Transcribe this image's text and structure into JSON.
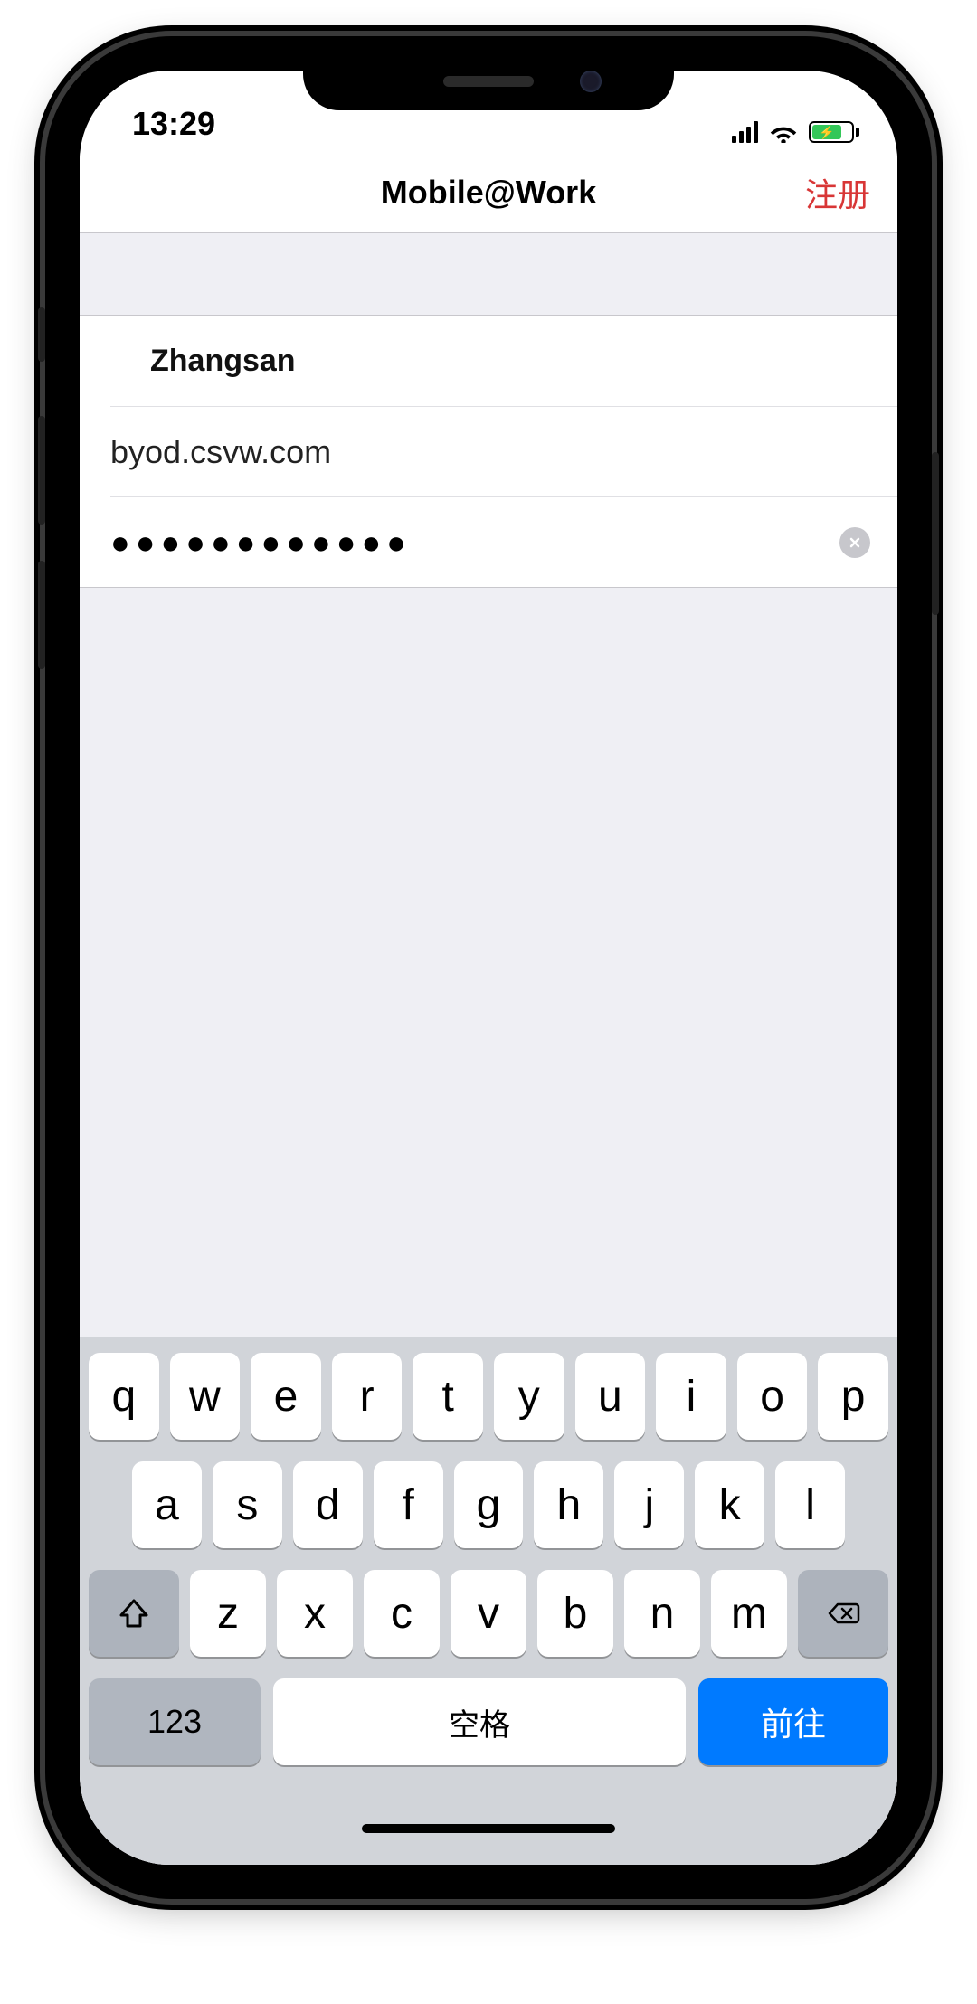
{
  "status": {
    "time": "13:29",
    "icons": {
      "signal": "cellular-signal-icon",
      "wifi": "wifi-icon",
      "battery": "battery-charging-icon"
    }
  },
  "nav": {
    "title": "Mobile@Work",
    "right_action": "注册"
  },
  "form": {
    "username": "Zhangsan",
    "server": "byod.csvw.com",
    "password_mask": "●●●●●●●●●●●●",
    "clear_icon": "clear-icon"
  },
  "keyboard": {
    "row1": [
      "q",
      "w",
      "e",
      "r",
      "t",
      "y",
      "u",
      "i",
      "o",
      "p"
    ],
    "row2": [
      "a",
      "s",
      "d",
      "f",
      "g",
      "h",
      "j",
      "k",
      "l"
    ],
    "row3": [
      "z",
      "x",
      "c",
      "v",
      "b",
      "n",
      "m"
    ],
    "shift_icon": "shift-icon",
    "delete_icon": "backspace-icon",
    "numbers_label": "123",
    "space_label": "空格",
    "go_label": "前往"
  }
}
